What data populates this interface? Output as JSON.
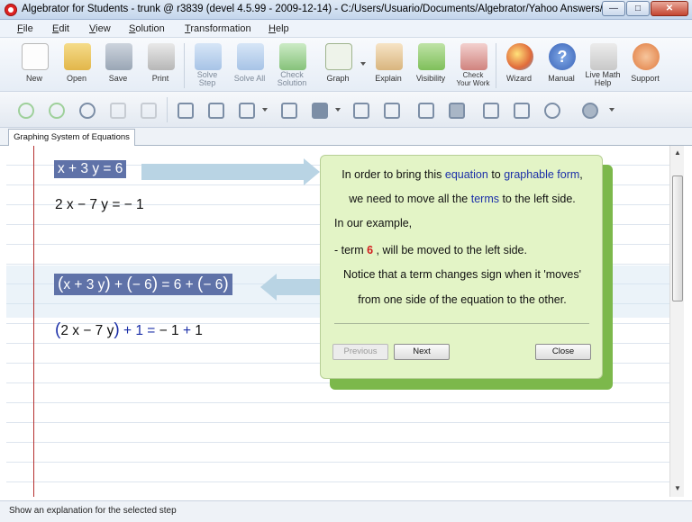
{
  "window": {
    "title": "Algebrator for Students - trunk @ r3839 (devel 4.5.99 - 2009-12-14) - C:/Users/Usuario/Documents/Algebrator/Yahoo Answers/Algebrator files ...",
    "min": "—",
    "max": "□",
    "close": "✕"
  },
  "menu": [
    "File",
    "Edit",
    "View",
    "Solution",
    "Transformation",
    "Help"
  ],
  "toolbar": [
    {
      "label": "New",
      "icon": "new-document-icon"
    },
    {
      "label": "Open",
      "icon": "folder-icon"
    },
    {
      "label": "Save",
      "icon": "save-icon"
    },
    {
      "label": "Print",
      "icon": "print-icon"
    },
    {
      "label": "Solve\nStep",
      "icon": "solve-step-icon"
    },
    {
      "label": "Solve All",
      "icon": "solve-all-icon"
    },
    {
      "label": "Check\nSolution",
      "icon": "checkmark-icon"
    },
    {
      "label": "Graph",
      "icon": "graph-icon"
    },
    {
      "label": "Explain",
      "icon": "explain-icon"
    },
    {
      "label": "Visibility",
      "icon": "visibility-icon"
    },
    {
      "label": "Check\nYour Work",
      "icon": "check-work-icon"
    },
    {
      "label": "Wizard",
      "icon": "wizard-icon"
    },
    {
      "label": "Manual",
      "icon": "help-manual-icon"
    },
    {
      "label": "Live Math\nHelp",
      "icon": "live-help-icon"
    },
    {
      "label": "Support",
      "icon": "support-icon"
    }
  ],
  "tab": {
    "label": "Graphing System of Equations"
  },
  "equations": {
    "eq1": "x + 3 y = 6",
    "eq2": "2 x − 7 y = − 1",
    "eq3_a": "(",
    "eq3_b": "x + 3 y",
    "eq3_c": ")",
    "eq3_d": " + ",
    "eq3_e": "(",
    "eq3_f": "− 6",
    "eq3_g": ")",
    "eq3_h": " = 6 + ",
    "eq3_i": "(",
    "eq3_j": "− 6",
    "eq3_k": ")",
    "eq4_a": "(",
    "eq4_b": "2 x − 7 y",
    "eq4_c": ")",
    "eq4_d": " + 1 ",
    "eq4_e": "=",
    "eq4_f": " − 1 ",
    "eq4_g": "+",
    "eq4_h": " 1"
  },
  "popup": {
    "l1_a": "In order to bring this ",
    "l1_b": "equation",
    "l1_c": " to ",
    "l1_d": "graphable form",
    "l1_e": ",",
    "l2_a": "we need to move all the ",
    "l2_b": "terms",
    "l2_c": " to the left side.",
    "l3": "In our example,",
    "l4_a": "- term ",
    "l4_b": "6",
    "l4_c": " , will be moved to the left side.",
    "l5": "Notice that a term changes sign when it 'moves'",
    "l6": "from one side of the equation to the other.",
    "previous": "Previous",
    "next": "Next",
    "close": "Close"
  },
  "status": "Show an explanation for the selected step",
  "scrollbar": {
    "up": "▲",
    "down": "▼"
  }
}
